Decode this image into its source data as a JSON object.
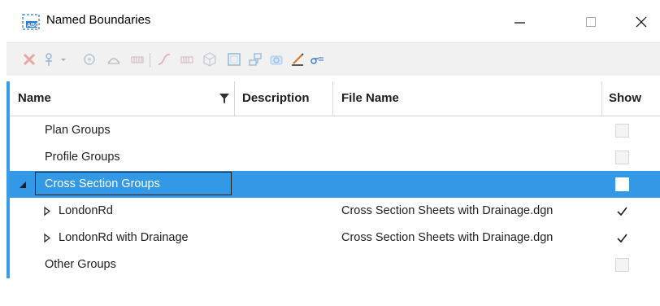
{
  "window": {
    "title": "Named Boundaries",
    "controls": [
      "minimize-icon",
      "maximize-icon",
      "close-icon"
    ]
  },
  "toolbar": {
    "icons": [
      "delete-icon",
      "filter-icon",
      "dropdown-icon",
      "boundary-icon",
      "arc-icon",
      "grid-icon",
      "curve-icon",
      "grid-small-icon",
      "solid-icon",
      "frame-icon",
      "layout-icon",
      "camera-icon",
      "pen-icon",
      "sigma-icon"
    ],
    "accent_color": "#d9534f"
  },
  "table": {
    "columns": {
      "name": "Name",
      "description": "Description",
      "file_name": "File Name",
      "show": "Show"
    },
    "rows": [
      {
        "name": "Plan Groups",
        "file": "",
        "show": false
      },
      {
        "name": "Profile Groups",
        "file": "",
        "show": false
      },
      {
        "name": "Cross Section Groups",
        "file": "",
        "show": false,
        "selected": true,
        "expanded": true
      },
      {
        "name": "LondonRd",
        "file": "Cross Section Sheets with Drainage.dgn",
        "show": true,
        "child": true
      },
      {
        "name": "LondonRd with Drainage",
        "file": "Cross Section Sheets with Drainage.dgn",
        "show": true,
        "child": true
      },
      {
        "name": "Other Groups",
        "file": "",
        "show": false
      }
    ],
    "selection_color": "#3399e6"
  }
}
